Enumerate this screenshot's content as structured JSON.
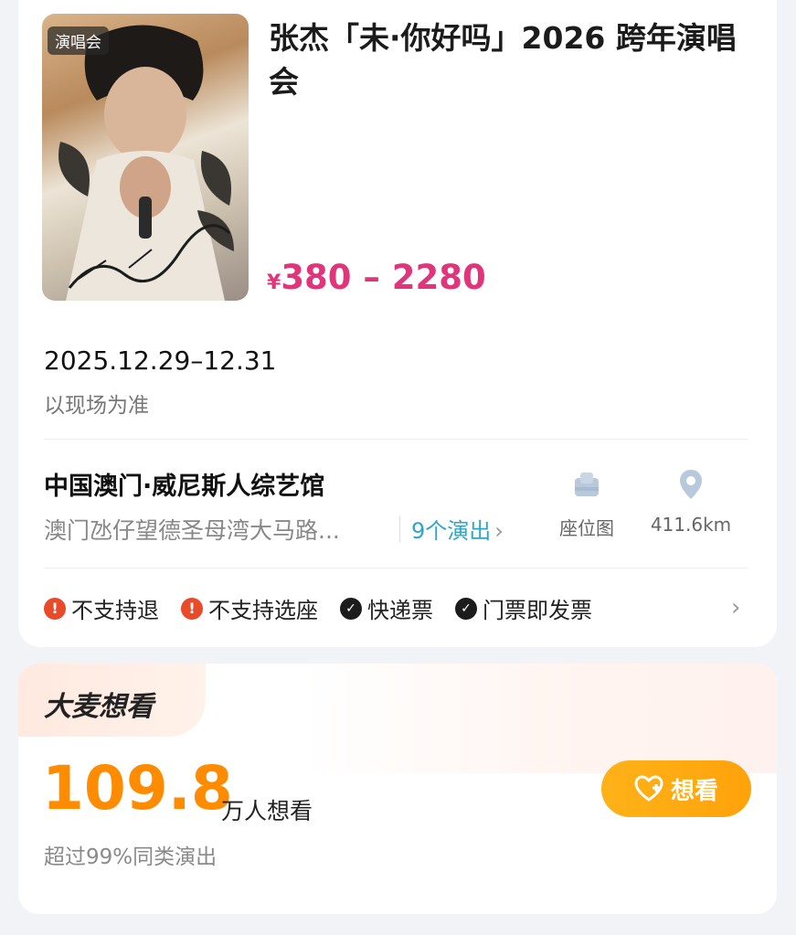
{
  "event": {
    "badge": "演唱会",
    "title": "张杰「未·你好吗」2026 跨年演唱会",
    "price_symbol": "¥",
    "price_range": "380 – 2280",
    "date": "2025.12.29–12.31",
    "date_note": "以现场为准"
  },
  "venue": {
    "name": "中国澳门·威尼斯人综艺馆",
    "address": "澳门氹仔望德圣母湾大马路...",
    "shows_link": "9个演出",
    "seat_map_label": "座位图",
    "distance": "411.6km"
  },
  "features": [
    {
      "label": "不支持退",
      "status": "warn"
    },
    {
      "label": "不支持选座",
      "status": "warn"
    },
    {
      "label": "快递票",
      "status": "ok"
    },
    {
      "label": "门票即发票",
      "status": "ok"
    }
  ],
  "interest": {
    "brand": "大麦想看",
    "count": "109.8",
    "count_unit": "万人想看",
    "note": "超过99%同类演出",
    "button_label": "想看"
  },
  "colors": {
    "price": "#e0357a",
    "count": "#ff8b00",
    "link": "#2ea6c8",
    "warn": "#e84a2a",
    "button": "#ffa20b"
  },
  "icons": [
    "seat-map-icon",
    "location-pin-icon",
    "heart-plus-icon",
    "chevron-right-icon"
  ]
}
